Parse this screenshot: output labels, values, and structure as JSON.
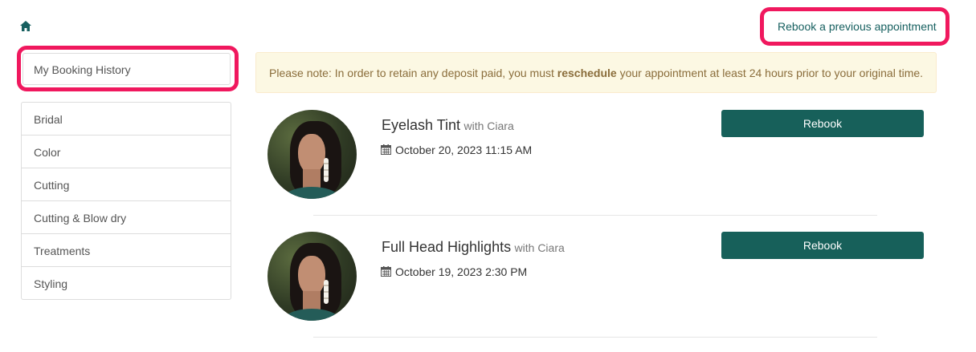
{
  "header": {
    "home_icon": "home-icon",
    "rebook_previous_label": "Rebook a previous appointment"
  },
  "sidebar": {
    "history_label": "My Booking History",
    "categories": [
      {
        "label": "Bridal"
      },
      {
        "label": "Color"
      },
      {
        "label": "Cutting"
      },
      {
        "label": "Cutting & Blow dry"
      },
      {
        "label": "Treatments"
      },
      {
        "label": "Styling"
      }
    ]
  },
  "notice": {
    "before": "Please note: In order to retain any deposit paid, you must ",
    "bold": "reschedule",
    "after": " your appointment at least 24 hours prior to your original time."
  },
  "appointments": [
    {
      "service": "Eyelash Tint",
      "staff": "with Ciara",
      "datetime": "October 20, 2023 11:15 AM",
      "button_label": "Rebook"
    },
    {
      "service": "Full Head Highlights",
      "staff": "with Ciara",
      "datetime": "October 19, 2023 2:30 PM",
      "button_label": "Rebook"
    }
  ],
  "colors": {
    "accent": "#17605a",
    "highlight": "#f0185e",
    "notice_bg": "#fcf8e3",
    "notice_text": "#8a6d3b"
  }
}
